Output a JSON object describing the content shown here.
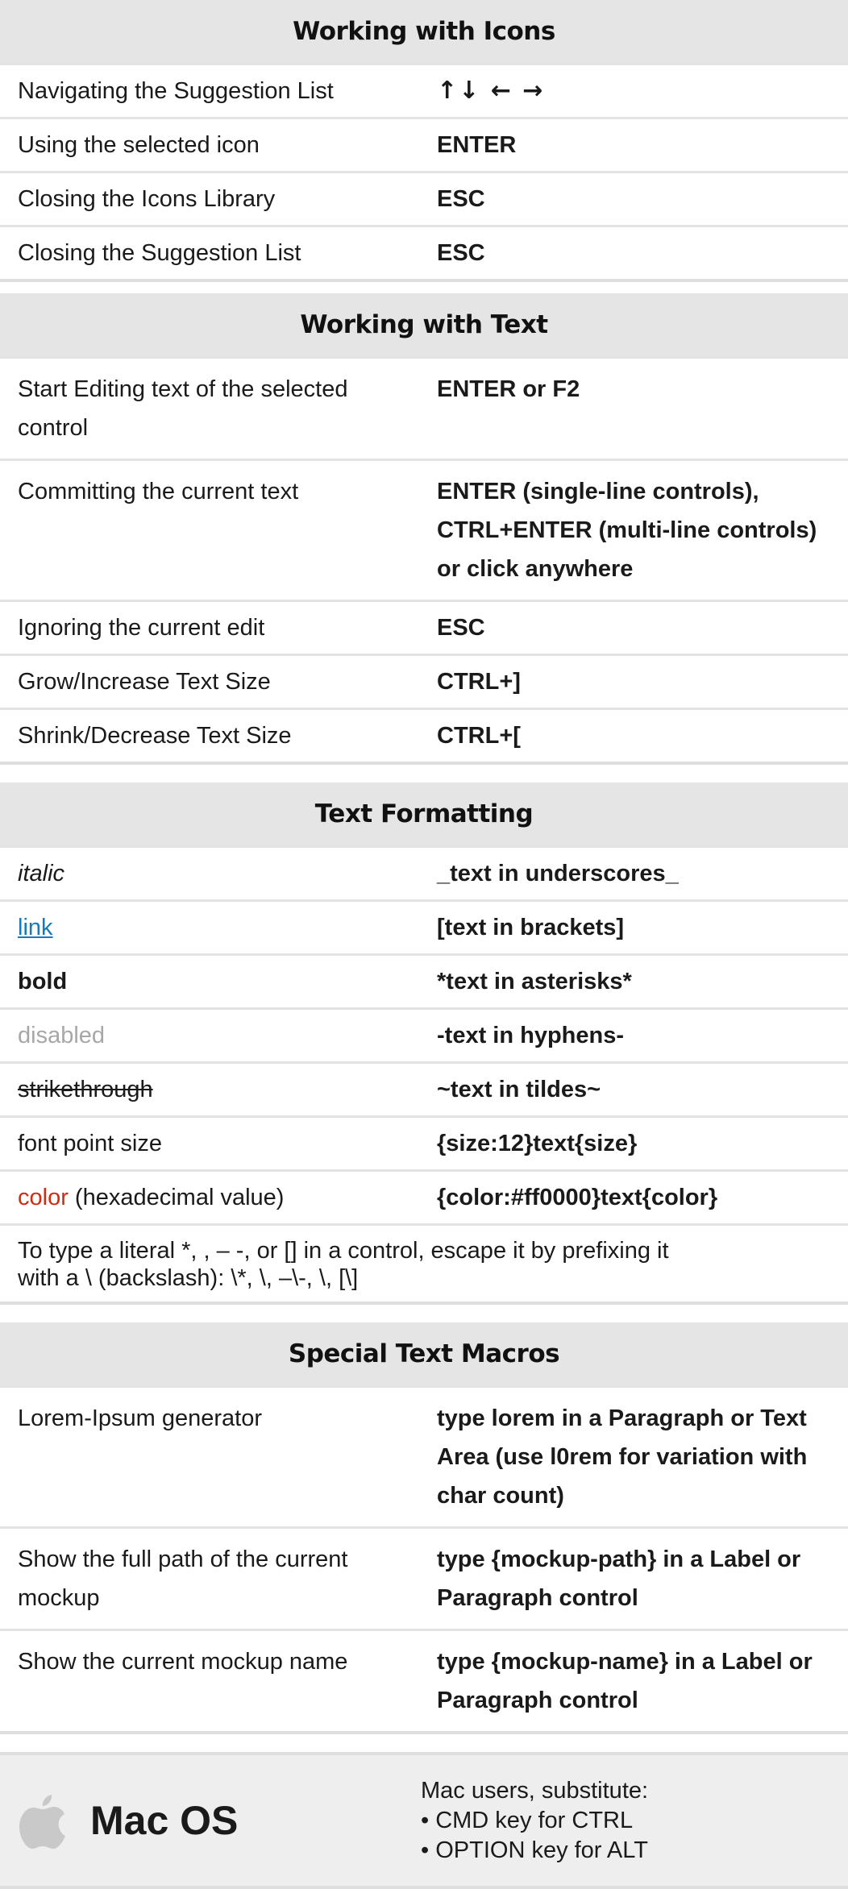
{
  "icons_section": {
    "title": "Working with Icons",
    "rows": [
      {
        "action": "Navigating the Suggestion List",
        "keys": "↑↓ ← →"
      },
      {
        "action": "Using the selected icon",
        "keys": "ENTER"
      },
      {
        "action": "Closing the Icons Library",
        "keys": "ESC"
      },
      {
        "action": "Closing the Suggestion List",
        "keys": "ESC"
      }
    ]
  },
  "text_section": {
    "title": "Working with Text",
    "rows": [
      {
        "action": "Start Editing text of the selected control",
        "keys": "ENTER or F2"
      },
      {
        "action": "Committing the current text",
        "keys": "ENTER (single-line controls), CTRL+ENTER (multi-line controls) or click anywhere"
      },
      {
        "action": "Ignoring the current edit",
        "keys": "ESC"
      },
      {
        "action": "Grow/Increase Text Size",
        "keys": "CTRL+]"
      },
      {
        "action": "Shrink/Decrease Text Size",
        "keys": "CTRL+["
      }
    ]
  },
  "formatting_section": {
    "title": "Text Formatting",
    "rows": [
      {
        "example": "italic",
        "syntax": "_text in underscores_"
      },
      {
        "example": "link",
        "syntax": "[text in brackets]"
      },
      {
        "example": "bold",
        "syntax": "*text in asterisks*"
      },
      {
        "example": "disabled",
        "syntax": "-text in hyphens-"
      },
      {
        "example": "strikethrough",
        "syntax": "~text in tildes~"
      },
      {
        "example": "font point size",
        "syntax": "{size:12}text{size}"
      },
      {
        "example_colored": "color",
        "example_rest": " (hexadecimal value)",
        "syntax": "{color:#ff0000}text{color}"
      }
    ],
    "note_line1": "To type a literal *, , – -,  or  [] in a control, escape it by prefixing it",
    "note_line2": "with a \\ (backslash): \\*, \\, –\\-, \\, [\\]"
  },
  "macros_section": {
    "title": "Special Text Macros",
    "rows": [
      {
        "action": "Lorem-Ipsum generator",
        "keys": "type lorem in a Paragraph or Text Area (use l0rem for variation with char count)"
      },
      {
        "action": "Show the full path of the current mockup",
        "keys": "type {mockup-path} in a Label or Paragraph control"
      },
      {
        "action": "Show the current mockup name",
        "keys": "type {mockup-name} in a Label or Paragraph control"
      }
    ]
  },
  "mac": {
    "icon": "apple-icon",
    "title": "Mac OS",
    "intro": "Mac users, substitute:",
    "items": [
      "• CMD key for CTRL",
      "• OPTION key for ALT"
    ]
  },
  "colors": {
    "header_bg": "#e5e5e5",
    "link": "#1a7ab8",
    "disabled": "#a7a7a7",
    "red": "#d32a12"
  }
}
